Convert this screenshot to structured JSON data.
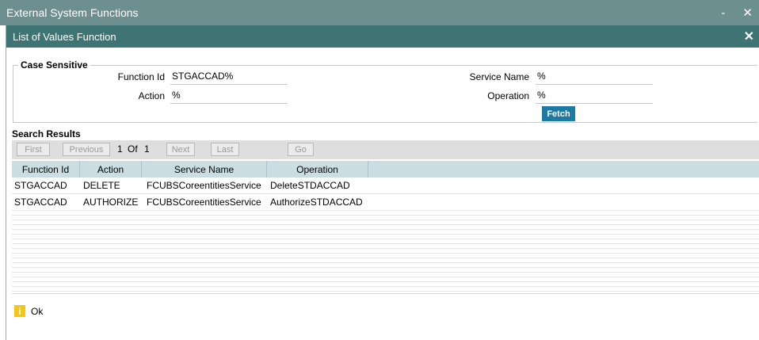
{
  "window": {
    "title": "External System Functions",
    "minimize": "-",
    "close": "✕"
  },
  "dialog": {
    "title": "List of Values Function",
    "close": "✕"
  },
  "criteria": {
    "legend": "Case Sensitive",
    "function_id_label": "Function Id",
    "function_id_value": "STGACCAD%",
    "action_label": "Action",
    "action_value": "%",
    "service_name_label": "Service Name",
    "service_name_value": "%",
    "operation_label": "Operation",
    "operation_value": "%",
    "fetch_label": "Fetch"
  },
  "results": {
    "title": "Search Results",
    "pager": {
      "first": "First",
      "previous": "Previous",
      "page": "1",
      "of": "Of",
      "total": "1",
      "next": "Next",
      "last": "Last",
      "go": "Go"
    },
    "columns": [
      "Function Id",
      "Action",
      "Service Name",
      "Operation"
    ],
    "rows": [
      [
        "STGACCAD",
        "DELETE",
        "FCUBSCoreentitiesService",
        "DeleteSTDACCAD"
      ],
      [
        "STGACCAD",
        "AUTHORIZE",
        "FCUBSCoreentitiesService",
        "AuthorizeSTDACCAD"
      ]
    ]
  },
  "footer": {
    "icon": "info-icon",
    "ok_label": "Ok"
  }
}
